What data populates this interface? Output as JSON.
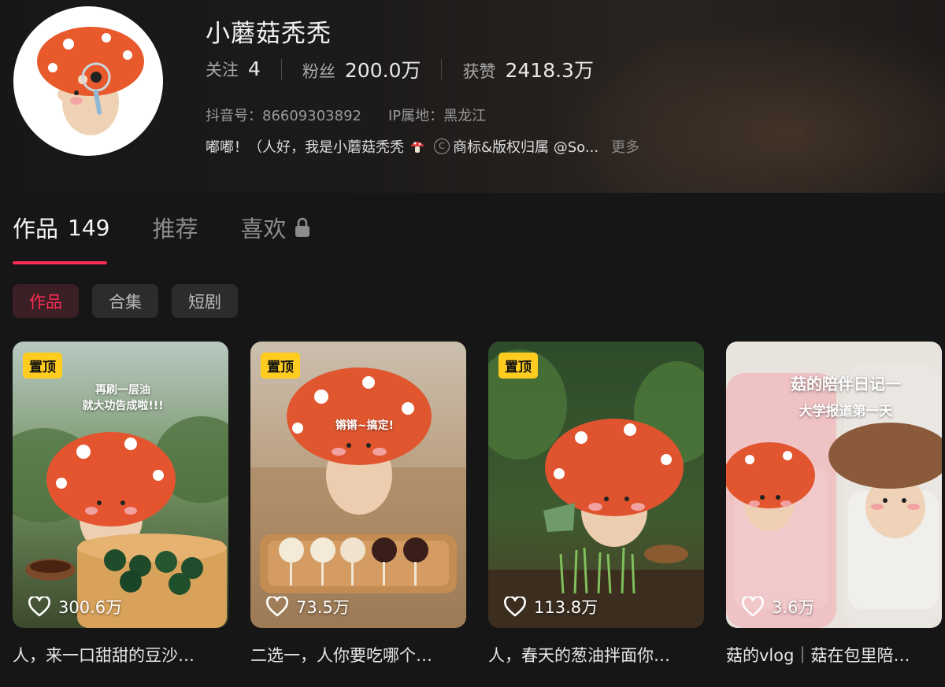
{
  "profile": {
    "name": "小蘑菇秃秃",
    "stats": [
      {
        "label": "关注",
        "value": "4"
      },
      {
        "label": "粉丝",
        "value": "200.0万"
      },
      {
        "label": "获赞",
        "value": "2418.3万"
      }
    ],
    "douyin_id": "抖音号：86609303892",
    "ip_location": "IP属地：黑龙江",
    "bio": "嘟嘟！（人好，我是小蘑菇秃秃",
    "bio_tail": "商标&版权归属 @So...",
    "more_label": "更多"
  },
  "tabs": [
    {
      "label": "作品",
      "count": "149"
    },
    {
      "label": "推荐"
    },
    {
      "label": "喜欢"
    }
  ],
  "chips": [
    "作品",
    "合集",
    "短剧"
  ],
  "videos": [
    {
      "pinned": "置顶",
      "likes": "300.6万",
      "caption": "人，来一口甜甜的豆沙…",
      "overlay": "再刷一层油\n就大功告成啦!!!"
    },
    {
      "pinned": "置顶",
      "likes": "73.5万",
      "caption": "二选一，人你要吃哪个…",
      "overlay": "锵锵~搞定!"
    },
    {
      "pinned": "置顶",
      "likes": "113.8万",
      "caption": "人，春天的葱油拌面你…",
      "overlay": ""
    },
    {
      "likes": "3.6万",
      "caption": "菇的vlog｜菇在包里陪…",
      "overlay_line1": "菇的陪伴日记一",
      "overlay_line2": "大学报道第一天"
    }
  ],
  "colors": {
    "accent": "#fe2c55",
    "pin": "#ffcc1f",
    "background": "#161616"
  }
}
